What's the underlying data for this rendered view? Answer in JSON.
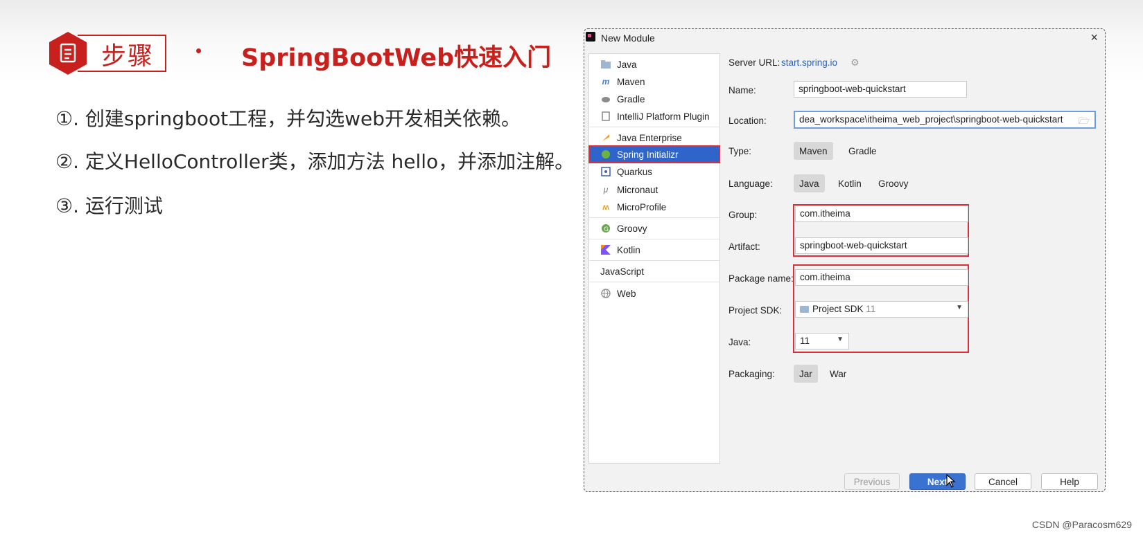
{
  "slide": {
    "badge_label": "步骤",
    "bullet": "•",
    "title": "SpringBootWeb快速入门",
    "steps": [
      "①. 创建springboot工程，并勾选web开发相关依赖。",
      "②. 定义HelloController类，添加方法 hello，并添加注解。",
      "③. 运行测试"
    ],
    "accent_color": "#c8201c"
  },
  "dialog": {
    "title": "New Module",
    "close": "×",
    "sidebar": [
      {
        "label": "Java",
        "icon": "folder-icon"
      },
      {
        "label": "Maven",
        "icon": "maven-icon"
      },
      {
        "label": "Gradle",
        "icon": "gradle-icon"
      },
      {
        "label": "IntelliJ Platform Plugin",
        "icon": "plugin-icon"
      },
      {
        "label": "Java Enterprise",
        "icon": "java-enterprise-icon"
      },
      {
        "label": "Spring Initializr",
        "icon": "spring-icon",
        "selected": true
      },
      {
        "label": "Quarkus",
        "icon": "quarkus-icon"
      },
      {
        "label": "Micronaut",
        "icon": "micronaut-icon"
      },
      {
        "label": "MicroProfile",
        "icon": "microprofile-icon"
      },
      {
        "label": "Groovy",
        "icon": "groovy-icon"
      },
      {
        "label": "Kotlin",
        "icon": "kotlin-icon"
      },
      {
        "label": "JavaScript",
        "icon": ""
      },
      {
        "label": "Web",
        "icon": "globe-icon"
      }
    ],
    "form": {
      "server_url_label": "Server URL:",
      "server_url": "start.spring.io",
      "name_label": "Name:",
      "name": "springboot-web-quickstart",
      "location_label": "Location:",
      "location": "dea_workspace\\itheima_web_project\\springboot-web-quickstart",
      "type_label": "Type:",
      "type_options": [
        "Maven",
        "Gradle"
      ],
      "language_label": "Language:",
      "language_options": [
        "Java",
        "Kotlin",
        "Groovy"
      ],
      "group_label": "Group:",
      "group": "com.itheima",
      "artifact_label": "Artifact:",
      "artifact": "springboot-web-quickstart",
      "package_label": "Package name:",
      "package": "com.itheima",
      "sdk_label": "Project SDK:",
      "sdk_name": "Project SDK",
      "sdk_version": "11",
      "java_label": "Java:",
      "java_version": "11",
      "packaging_label": "Packaging:",
      "packaging_options": [
        "Jar",
        "War"
      ]
    },
    "buttons": {
      "previous": "Previous",
      "next": "Next",
      "cancel": "Cancel",
      "help": "Help"
    }
  },
  "watermark": "CSDN @Paracosm629"
}
